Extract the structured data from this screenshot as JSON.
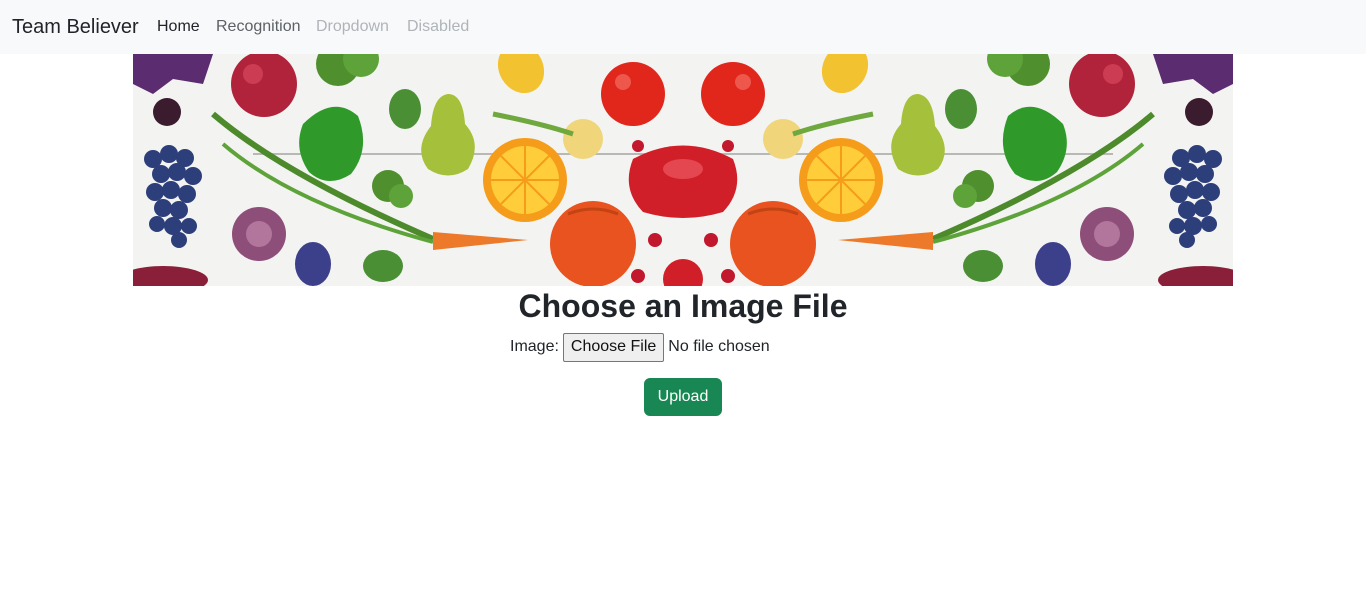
{
  "navbar": {
    "brand": "Team Believer",
    "links": [
      {
        "label": "Home",
        "state": "active"
      },
      {
        "label": "Recognition",
        "state": "normal"
      },
      {
        "label": "Dropdown",
        "state": "disabled"
      },
      {
        "label": "Disabled",
        "state": "disabled"
      }
    ]
  },
  "banner": {
    "description_icon": "vegetables-fruits-banner"
  },
  "main": {
    "title": "Choose an Image File",
    "file_label": "Image:",
    "choose_button": "Choose File",
    "file_status": "No file chosen",
    "upload_button": "Upload"
  },
  "colors": {
    "navbar_bg": "#f8f9fa",
    "upload_bg": "#198754",
    "text": "#212529"
  }
}
